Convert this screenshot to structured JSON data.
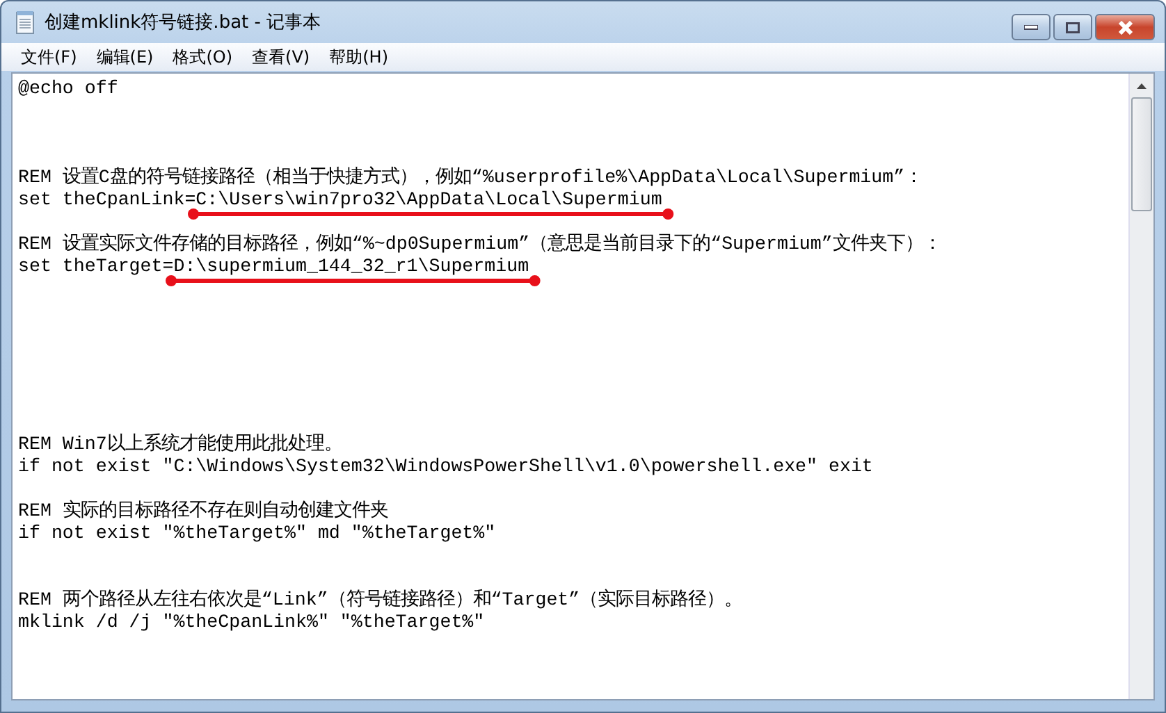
{
  "window": {
    "title": "创建mklink符号链接.bat - 记事本"
  },
  "menu": [
    "文件(F)",
    "编辑(E)",
    "格式(O)",
    "查看(V)",
    "帮助(H)"
  ],
  "lines": [
    {
      "kind": "code",
      "text": "@echo off"
    },
    {
      "kind": "blank"
    },
    {
      "kind": "blank"
    },
    {
      "kind": "blank"
    },
    {
      "kind": "code",
      "text": "REM 设置C盘的符号链接路径（相当于快捷方式），例如“%userprofile%\\AppData\\Local\\Supermium”："
    },
    {
      "kind": "code",
      "text": "set theCpanLink=C:\\Users\\win7pro32\\AppData\\Local\\Supermium",
      "underlined": true
    },
    {
      "kind": "blank"
    },
    {
      "kind": "code",
      "text": "REM 设置实际文件存储的目标路径，例如“%~dp0Supermium”（意思是当前目录下的“Supermium”文件夹下）："
    },
    {
      "kind": "code",
      "text": "set theTarget=D:\\supermium_144_32_r1\\Supermium",
      "underlined": true
    },
    {
      "kind": "blank"
    },
    {
      "kind": "blank"
    },
    {
      "kind": "blank"
    },
    {
      "kind": "blank"
    },
    {
      "kind": "blank"
    },
    {
      "kind": "blank"
    },
    {
      "kind": "blank"
    },
    {
      "kind": "code",
      "text": "REM Win7以上系统才能使用此批处理。"
    },
    {
      "kind": "code",
      "text": "if not exist \"C:\\Windows\\System32\\WindowsPowerShell\\v1.0\\powershell.exe\" exit"
    },
    {
      "kind": "blank"
    },
    {
      "kind": "code",
      "text": "REM 实际的目标路径不存在则自动创建文件夹"
    },
    {
      "kind": "code",
      "text": "if not exist \"%theTarget%\" md \"%theTarget%\""
    },
    {
      "kind": "blank"
    },
    {
      "kind": "blank"
    },
    {
      "kind": "code",
      "text": "REM 两个路径从左往右依次是“Link”（符号链接路径）和“Target”（实际目标路径）。"
    },
    {
      "kind": "code",
      "text": "mklink /d /j \"%theCpanLink%\" \"%theTarget%\""
    }
  ]
}
